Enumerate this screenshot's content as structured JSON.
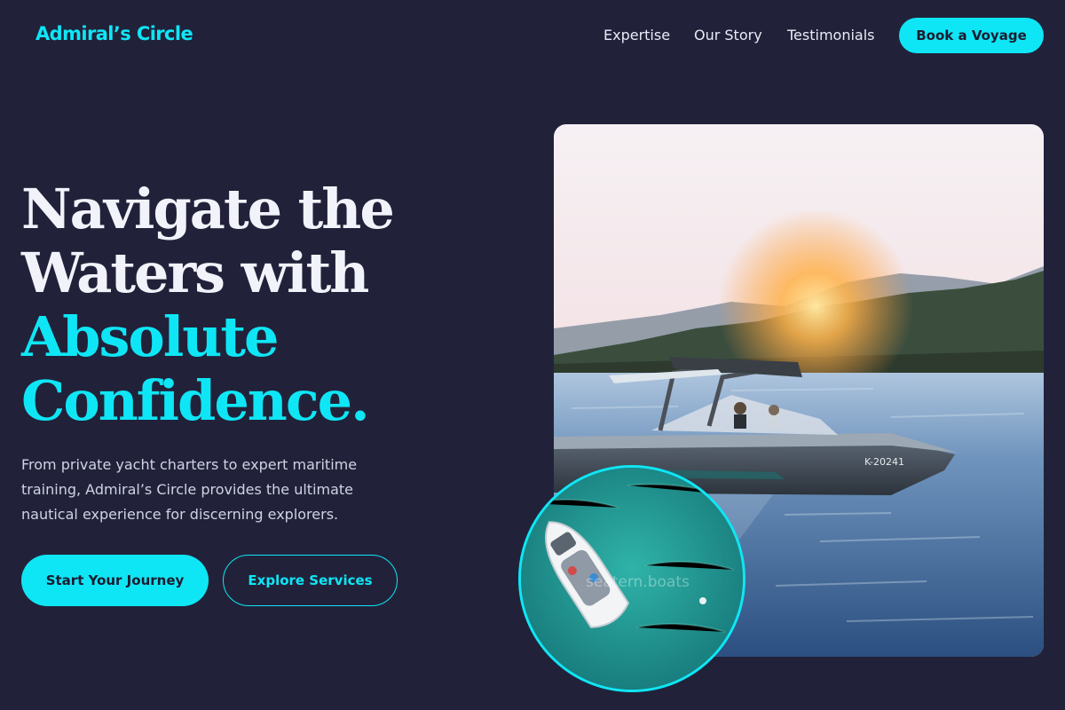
{
  "brand": {
    "name": "Admiral’s Circle"
  },
  "nav": {
    "items": [
      {
        "label": "Expertise"
      },
      {
        "label": "Our Story"
      },
      {
        "label": "Testimonials"
      }
    ],
    "cta_label": "Book a Voyage"
  },
  "hero": {
    "headline_lines": [
      "Navigate the",
      "Waters with",
      "Absolute",
      "Confidence."
    ],
    "subtext": "From private yacht charters to expert maritime training, Admiral’s Circle provides the ultimate nautical experience for discerning explorers.",
    "primary_button": "Start Your Journey",
    "secondary_button": "Explore Services",
    "photo_hull_text": "K-20241",
    "watermark_text": "seatern.boats"
  },
  "colors": {
    "background": "#21223a",
    "accent": "#0fe6f5",
    "text_light": "#f2f3fa",
    "text_muted": "#cfd3e3"
  },
  "icons": {
    "hero_photo": "speedboat-sunset-photo",
    "inset_photo": "aerial-boat-photo"
  }
}
